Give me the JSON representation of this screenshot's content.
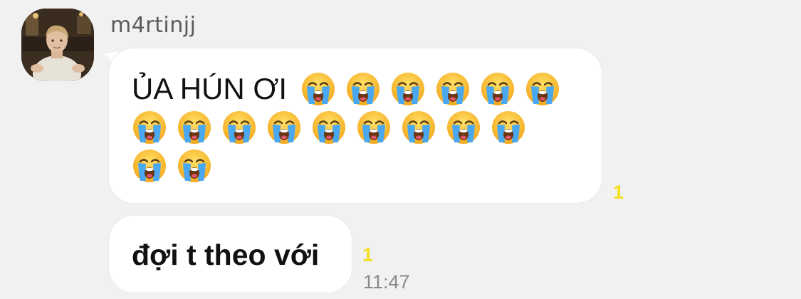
{
  "chat": {
    "sender_name": "m4rtinjj",
    "messages": [
      {
        "text": "ỦA HÚN ƠI",
        "emoji": "loudly-crying-face",
        "emoji_rows": [
          6,
          9,
          2
        ],
        "read_count": "1"
      },
      {
        "text": "đợi t theo với",
        "read_count": "1",
        "time": "11:47"
      }
    ]
  },
  "colors": {
    "background": "#f1f1f2",
    "bubble": "#ffffff",
    "read_count": "#f2e11a",
    "time": "#8a8a8a",
    "sender": "#5a5a5a"
  },
  "icons": {
    "avatar": "profile-photo",
    "emoji": "loudly-crying-face-emoji"
  }
}
